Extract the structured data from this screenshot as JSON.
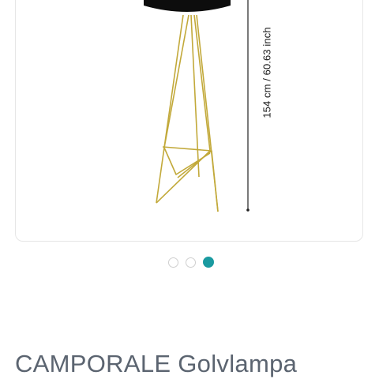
{
  "product": {
    "title": "CAMPORALE Golvlampa",
    "dimension_label": "154 cm / 60.63 inch"
  },
  "carousel": {
    "slide_count": 3,
    "active_index": 2,
    "active_color": "#1a9aa0"
  },
  "colors": {
    "frame_gold": "#c2a93a",
    "shade_black": "#0d0d0d"
  }
}
